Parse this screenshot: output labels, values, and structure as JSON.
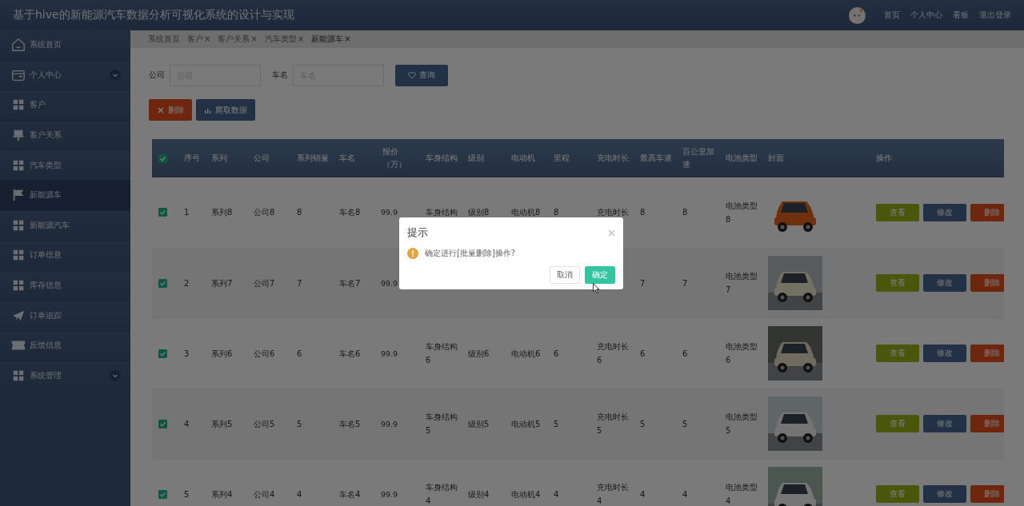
{
  "header": {
    "title": "基于hive的新能源汽车数据分析可视化系统的设计与实现",
    "nav": [
      "首页",
      "个人中心",
      "看板",
      "退出登录"
    ]
  },
  "sidebar": {
    "items": [
      {
        "label": "系统首页",
        "selected": false,
        "has_submenu": false
      },
      {
        "label": "个人中心",
        "selected": false,
        "has_submenu": true
      },
      {
        "label": "客户",
        "selected": false,
        "has_submenu": false
      },
      {
        "label": "客户关系",
        "selected": false,
        "has_submenu": false
      },
      {
        "label": "汽车类型",
        "selected": false,
        "has_submenu": false
      },
      {
        "label": "新能源车",
        "selected": true,
        "has_submenu": false
      },
      {
        "label": "新能源汽车",
        "selected": false,
        "has_submenu": false
      },
      {
        "label": "订单信息",
        "selected": false,
        "has_submenu": false
      },
      {
        "label": "库存信息",
        "selected": false,
        "has_submenu": false
      },
      {
        "label": "订单追踪",
        "selected": false,
        "has_submenu": false
      },
      {
        "label": "反馈信息",
        "selected": false,
        "has_submenu": false
      },
      {
        "label": "系统管理",
        "selected": false,
        "has_submenu": true
      }
    ]
  },
  "breadcrumbs": [
    {
      "label": "系统首页",
      "selected": false
    },
    {
      "label": "客户",
      "close": "×",
      "selected": false
    },
    {
      "label": "客户关系",
      "close": "×",
      "selected": false
    },
    {
      "label": "汽车类型",
      "close": "×",
      "selected": false
    },
    {
      "label": "新能源车",
      "close": "×",
      "selected": true
    }
  ],
  "search": {
    "fields": [
      {
        "label": "公司",
        "placeholder": "公司"
      },
      {
        "label": "车名",
        "placeholder": "车名"
      }
    ],
    "button": "查询"
  },
  "actions": [
    {
      "label": "删除",
      "kind": "danger"
    },
    {
      "label": "爬取数据",
      "kind": "primary"
    }
  ],
  "table": {
    "all_checked": true,
    "columns": [
      "序号",
      "系列",
      "公司",
      "系列销量",
      "车名",
      "报价（万）",
      "车身结构",
      "级别",
      "电动机",
      "里程",
      "充电时长",
      "最高车速",
      "百公里加速",
      "电池类型",
      "封面",
      "操作"
    ],
    "rows": [
      {
        "checked": true,
        "cells": [
          "1",
          "系列8",
          "公司8",
          "8",
          "车名8",
          "99.9",
          "车身结构",
          "级别8",
          "电动机8",
          "8",
          "充电时长",
          "8",
          "8",
          "电池类型8"
        ],
        "cover": {
          "kind": "picture"
        },
        "buttons": [
          {
            "label": "查看",
            "kind": "view"
          },
          {
            "label": "修改",
            "kind": "edit"
          },
          {
            "label": "删除",
            "kind": "delete"
          }
        ]
      },
      {
        "checked": true,
        "cells": [
          "2",
          "系列7",
          "公司7",
          "7",
          "车名7",
          "99.9",
          null,
          null,
          null,
          null,
          null,
          "7",
          "7",
          "电池类型7"
        ],
        "cover": {
          "kind": "picture"
        },
        "buttons": [
          {
            "label": "查看",
            "kind": "view"
          },
          {
            "label": "修改",
            "kind": "edit"
          },
          {
            "label": "删除",
            "kind": "delete"
          }
        ]
      },
      {
        "checked": true,
        "cells": [
          "3",
          "系列6",
          "公司6",
          "6",
          "车名6",
          "99.9",
          "车身结构6",
          "级别6",
          "电动机6",
          "6",
          "充电时长6",
          "6",
          "6",
          "电池类型6"
        ],
        "cover": {
          "kind": "picture"
        },
        "buttons": [
          {
            "label": "查看",
            "kind": "view"
          },
          {
            "label": "修改",
            "kind": "edit"
          },
          {
            "label": "删除",
            "kind": "delete"
          }
        ]
      },
      {
        "checked": true,
        "cells": [
          "4",
          "系列5",
          "公司5",
          "5",
          "车名5",
          "99.9",
          "车身结构5",
          "级别5",
          "电动机5",
          "5",
          "充电时长5",
          "5",
          "5",
          "电池类型5"
        ],
        "cover": {
          "kind": "picture"
        },
        "buttons": [
          {
            "label": "查看",
            "kind": "view"
          },
          {
            "label": "修改",
            "kind": "edit"
          },
          {
            "label": "删除",
            "kind": "delete"
          }
        ]
      },
      {
        "checked": true,
        "cells": [
          "5",
          "系列4",
          "公司4",
          "4",
          "车名4",
          "99.9",
          "车身结构4",
          "级别4",
          "电动机4",
          "4",
          "充电时长4",
          "4",
          "4",
          "电池类型4"
        ],
        "cover": {
          "kind": "picture"
        },
        "buttons": [
          {
            "label": "查看",
            "kind": "view"
          },
          {
            "label": "修改",
            "kind": "edit"
          },
          {
            "label": "删除",
            "kind": "delete"
          }
        ]
      }
    ]
  },
  "dialog": {
    "title": "提示",
    "message": "确定进行[批量删除]操作?",
    "buttons": [
      {
        "label": "取消",
        "kind": "default"
      },
      {
        "label": "确定",
        "kind": "primary"
      }
    ]
  }
}
